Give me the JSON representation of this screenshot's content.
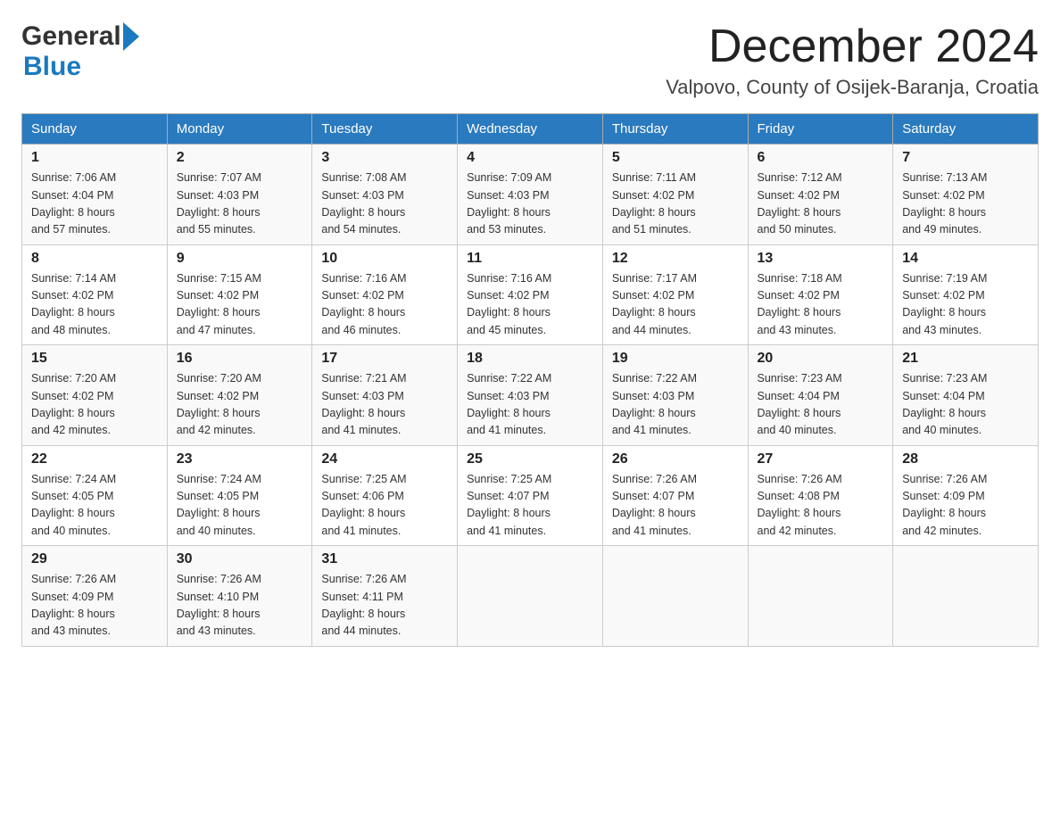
{
  "header": {
    "logo_general": "General",
    "logo_blue": "Blue",
    "month_title": "December 2024",
    "location": "Valpovo, County of Osijek-Baranja, Croatia"
  },
  "weekdays": [
    "Sunday",
    "Monday",
    "Tuesday",
    "Wednesday",
    "Thursday",
    "Friday",
    "Saturday"
  ],
  "weeks": [
    [
      {
        "day": "1",
        "sunrise": "7:06 AM",
        "sunset": "4:04 PM",
        "daylight": "8 hours and 57 minutes."
      },
      {
        "day": "2",
        "sunrise": "7:07 AM",
        "sunset": "4:03 PM",
        "daylight": "8 hours and 55 minutes."
      },
      {
        "day": "3",
        "sunrise": "7:08 AM",
        "sunset": "4:03 PM",
        "daylight": "8 hours and 54 minutes."
      },
      {
        "day": "4",
        "sunrise": "7:09 AM",
        "sunset": "4:03 PM",
        "daylight": "8 hours and 53 minutes."
      },
      {
        "day": "5",
        "sunrise": "7:11 AM",
        "sunset": "4:02 PM",
        "daylight": "8 hours and 51 minutes."
      },
      {
        "day": "6",
        "sunrise": "7:12 AM",
        "sunset": "4:02 PM",
        "daylight": "8 hours and 50 minutes."
      },
      {
        "day": "7",
        "sunrise": "7:13 AM",
        "sunset": "4:02 PM",
        "daylight": "8 hours and 49 minutes."
      }
    ],
    [
      {
        "day": "8",
        "sunrise": "7:14 AM",
        "sunset": "4:02 PM",
        "daylight": "8 hours and 48 minutes."
      },
      {
        "day": "9",
        "sunrise": "7:15 AM",
        "sunset": "4:02 PM",
        "daylight": "8 hours and 47 minutes."
      },
      {
        "day": "10",
        "sunrise": "7:16 AM",
        "sunset": "4:02 PM",
        "daylight": "8 hours and 46 minutes."
      },
      {
        "day": "11",
        "sunrise": "7:16 AM",
        "sunset": "4:02 PM",
        "daylight": "8 hours and 45 minutes."
      },
      {
        "day": "12",
        "sunrise": "7:17 AM",
        "sunset": "4:02 PM",
        "daylight": "8 hours and 44 minutes."
      },
      {
        "day": "13",
        "sunrise": "7:18 AM",
        "sunset": "4:02 PM",
        "daylight": "8 hours and 43 minutes."
      },
      {
        "day": "14",
        "sunrise": "7:19 AM",
        "sunset": "4:02 PM",
        "daylight": "8 hours and 43 minutes."
      }
    ],
    [
      {
        "day": "15",
        "sunrise": "7:20 AM",
        "sunset": "4:02 PM",
        "daylight": "8 hours and 42 minutes."
      },
      {
        "day": "16",
        "sunrise": "7:20 AM",
        "sunset": "4:02 PM",
        "daylight": "8 hours and 42 minutes."
      },
      {
        "day": "17",
        "sunrise": "7:21 AM",
        "sunset": "4:03 PM",
        "daylight": "8 hours and 41 minutes."
      },
      {
        "day": "18",
        "sunrise": "7:22 AM",
        "sunset": "4:03 PM",
        "daylight": "8 hours and 41 minutes."
      },
      {
        "day": "19",
        "sunrise": "7:22 AM",
        "sunset": "4:03 PM",
        "daylight": "8 hours and 41 minutes."
      },
      {
        "day": "20",
        "sunrise": "7:23 AM",
        "sunset": "4:04 PM",
        "daylight": "8 hours and 40 minutes."
      },
      {
        "day": "21",
        "sunrise": "7:23 AM",
        "sunset": "4:04 PM",
        "daylight": "8 hours and 40 minutes."
      }
    ],
    [
      {
        "day": "22",
        "sunrise": "7:24 AM",
        "sunset": "4:05 PM",
        "daylight": "8 hours and 40 minutes."
      },
      {
        "day": "23",
        "sunrise": "7:24 AM",
        "sunset": "4:05 PM",
        "daylight": "8 hours and 40 minutes."
      },
      {
        "day": "24",
        "sunrise": "7:25 AM",
        "sunset": "4:06 PM",
        "daylight": "8 hours and 41 minutes."
      },
      {
        "day": "25",
        "sunrise": "7:25 AM",
        "sunset": "4:07 PM",
        "daylight": "8 hours and 41 minutes."
      },
      {
        "day": "26",
        "sunrise": "7:26 AM",
        "sunset": "4:07 PM",
        "daylight": "8 hours and 41 minutes."
      },
      {
        "day": "27",
        "sunrise": "7:26 AM",
        "sunset": "4:08 PM",
        "daylight": "8 hours and 42 minutes."
      },
      {
        "day": "28",
        "sunrise": "7:26 AM",
        "sunset": "4:09 PM",
        "daylight": "8 hours and 42 minutes."
      }
    ],
    [
      {
        "day": "29",
        "sunrise": "7:26 AM",
        "sunset": "4:09 PM",
        "daylight": "8 hours and 43 minutes."
      },
      {
        "day": "30",
        "sunrise": "7:26 AM",
        "sunset": "4:10 PM",
        "daylight": "8 hours and 43 minutes."
      },
      {
        "day": "31",
        "sunrise": "7:26 AM",
        "sunset": "4:11 PM",
        "daylight": "8 hours and 44 minutes."
      },
      null,
      null,
      null,
      null
    ]
  ],
  "labels": {
    "sunrise": "Sunrise:",
    "sunset": "Sunset:",
    "daylight": "Daylight:"
  }
}
